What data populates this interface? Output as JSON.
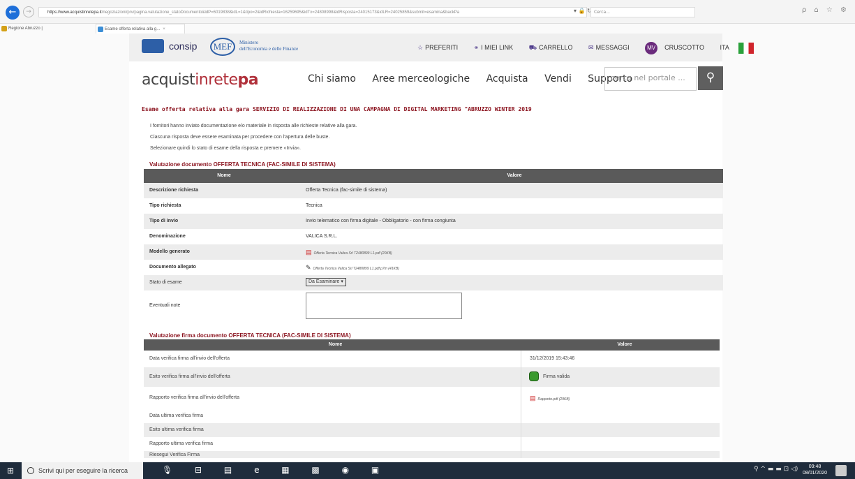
{
  "browser": {
    "url_domain": "https://www.acquistinretepa.it",
    "url_path": "/negoziazioni/prv/pagina.valutazione_statoDocumento&idP=6019838&idL=1&tipo=2&idRichiesta=16259695&idTx=24808998&idRisposta=24015173&idLR=24025859&submit=esamina&backPa",
    "url_icons": "▾ 🔒 ↻",
    "search_placeholder": "Cerca...",
    "toolbar_icons": "ρ ⌂ ☆ ⚙",
    "tabs": [
      {
        "label": "Regione Abruzzo |"
      },
      {
        "label": "Esame offerta relativa alla g...",
        "close": "×"
      }
    ]
  },
  "top_strip": {
    "consip": "consip",
    "mef_logo": "MEF",
    "mef_line1": "Ministero",
    "mef_line2": "dell'Economia e delle Finanze",
    "preferiti": "PREFERITI",
    "miei_link": "I MIEI LINK",
    "carrello": "CARRELLO",
    "messaggi": "MESSAGGI",
    "avatar": "MV",
    "cruscotto": "CRUSCOTTO",
    "lang": "ITA"
  },
  "header": {
    "brand_1": "acquist",
    "brand_2": "inrete",
    "brand_3": "pa",
    "nav": [
      "Chi siamo",
      "Aree merceologiche",
      "Acquista",
      "Vendi",
      "Supporto"
    ],
    "search_placeholder": "cerca nel portale ...",
    "search_icon": "⚲"
  },
  "content": {
    "title": "Esame offerta relativa alla gara SERVIZIO DI REALIZZAZIONE DI UNA CAMPAGNA DI DIGITAL MARKETING \"ABRUZZO WINTER 2019",
    "intro": [
      "I fornitori hanno inviato documentazione e/o materiale in risposta alle richieste relative alla gara.",
      "Ciascuna risposta deve essere esaminata per procedere con l'apertura delle buste.",
      "Selezionare quindi lo stato di esame della risposta e premere «Invia»."
    ],
    "section1_title": "Valutazione documento OFFERTA TECNICA (FAC-SIMILE DI SISTEMA)",
    "table1_headers": [
      "Nome",
      "Valore"
    ],
    "table1": {
      "descrizione_label": "Descrizione richiesta",
      "descrizione_value": "Offerta Tecnica (fac-simile di sistema)",
      "tipo_label": "Tipo richiesta",
      "tipo_value": "Tecnica",
      "invio_label": "Tipo di invio",
      "invio_value": "Invio telematico con firma digitale - Obbligatorio - con firma congiunta",
      "denominazione_label": "Denominazione",
      "denominazione_value": "VALICA S.R.L.",
      "modello_label": "Modello generato",
      "modello_value": "Offerta Tecnica Valica Srl T2480899 L1.pdf (20KB)",
      "allegato_label": "Documento allegato",
      "allegato_value": "Offerta Tecnica Valica Srl T2480899 L1.pdf.p7m (41KB)",
      "stato_label": "Stato di esame",
      "stato_value": "Da Esaminare",
      "note_label": "Eventuali note"
    },
    "section2_title": "Valutazione firma documento OFFERTA TECNICA (FAC-SIMILE DI SISTEMA)",
    "table2_headers": [
      "Nome",
      "Valore"
    ],
    "table2": {
      "data_label": "Data verifica firma all'invio dell'offerta",
      "data_value": "31/12/2019 15:43:46",
      "esito_label": "Esito verifica firma all'invio dell'offerta",
      "esito_value": "Firma valida",
      "rapporto_label": "Rapporto verifica firma all'invio dell'offerta",
      "rapporto_value": "Rapporto.pdf (29KB)",
      "data_ultima_label": "Data ultima verifica firma",
      "esito_ultima_label": "Esito ultima verifica firma",
      "rapporto_ultima_label": "Rapporto ultima verifica firma",
      "riesegui_label": "Riesegui Verifica Firma"
    }
  },
  "taskbar": {
    "search_placeholder": "Scrivi qui per eseguire la ricerca",
    "time": "09:48",
    "date": "08/01/2020",
    "apps": "🎙 ⊟ ▤ e ▦ ▩ ◉ ▣",
    "tray": "⚲ ^ ▬ ▬ ⊡ ◁)"
  },
  "colors": {
    "accent_red": "#8c1520",
    "header_gray": "#5a5a5a",
    "brand_red": "#b0303a",
    "avatar_purple": "#6a2b7c"
  }
}
